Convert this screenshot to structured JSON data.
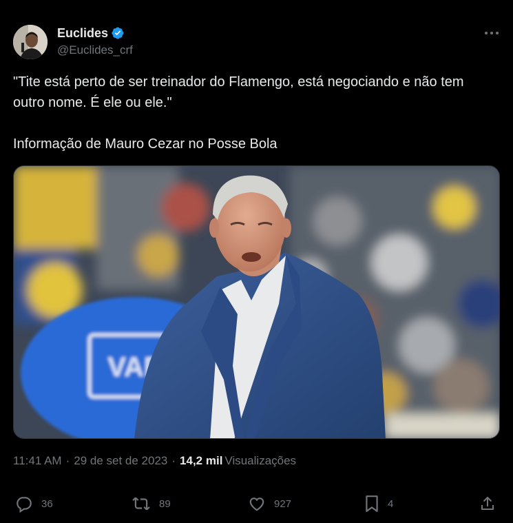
{
  "author": {
    "display_name": "Euclides",
    "handle": "@Euclides_crf",
    "verified": true
  },
  "tweet": {
    "text_line1": "\"Tite está perto de ser treinador do Flamengo, está negociando e não tem outro nome. É ele ou ele.\"",
    "text_line2": "Informação de Mauro Cezar no Posse Bola",
    "media_sign_text": "VAR"
  },
  "meta": {
    "time": "11:41 AM",
    "separator": "·",
    "date": "29 de set de 2023",
    "views_count": "14,2 mil",
    "views_label": "Visualizações"
  },
  "actions": {
    "replies": "36",
    "reposts": "89",
    "likes": "927",
    "bookmarks": "4"
  },
  "colors": {
    "background": "#000000",
    "text_primary": "#e7e9ea",
    "text_secondary": "#71767b",
    "verified_blue": "#1d9bf0",
    "border": "#2f3336"
  },
  "icons": [
    "verified-badge-icon",
    "more-options-icon",
    "reply-icon",
    "repost-icon",
    "like-icon",
    "bookmark-icon",
    "share-icon"
  ]
}
